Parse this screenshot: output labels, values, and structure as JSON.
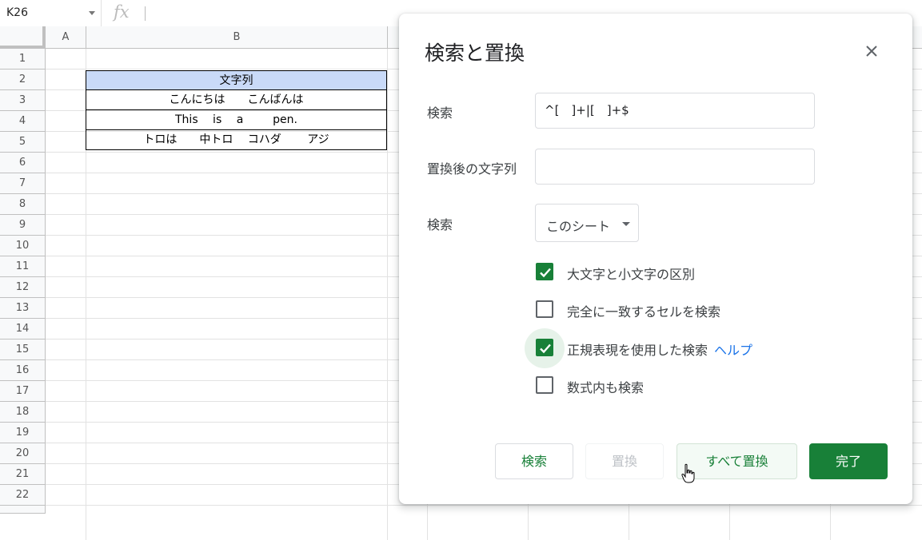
{
  "formula_bar": {
    "name_box": "K26",
    "fx_symbol": "fx",
    "formula": ""
  },
  "columns": [
    "A",
    "B"
  ],
  "rows": [
    "1",
    "2",
    "3",
    "4",
    "5",
    "6",
    "7",
    "8",
    "9",
    "10",
    "11",
    "12",
    "13",
    "14",
    "15",
    "16",
    "17",
    "18",
    "19",
    "20",
    "21",
    "22"
  ],
  "table": {
    "header": "文字列",
    "cells": [
      "こんにちは　　こんばんは",
      "This　 is 　a　　  pen.",
      "トロは　　中トロ　 コハダ　　 アジ"
    ],
    "header_color": "#c9daf8"
  },
  "dialog": {
    "title": "検索と置換",
    "search_label": "検索",
    "search_value": "^[　]+|[　]+$",
    "replace_label": "置換後の文字列",
    "replace_value": "",
    "scope_label": "検索",
    "scope_value": "このシート",
    "options": [
      {
        "label": "大文字と小文字の区別",
        "checked": true
      },
      {
        "label": "完全に一致するセルを検索",
        "checked": false
      },
      {
        "label": "正規表現を使用した検索",
        "checked": true
      },
      {
        "label": "数式内も検索",
        "checked": false
      }
    ],
    "help_link": "ヘルプ",
    "buttons": {
      "find": "検索",
      "replace": "置換",
      "replace_all": "すべて置換",
      "done": "完了"
    },
    "accent_color": "#188038",
    "link_color": "#1a73e8"
  }
}
